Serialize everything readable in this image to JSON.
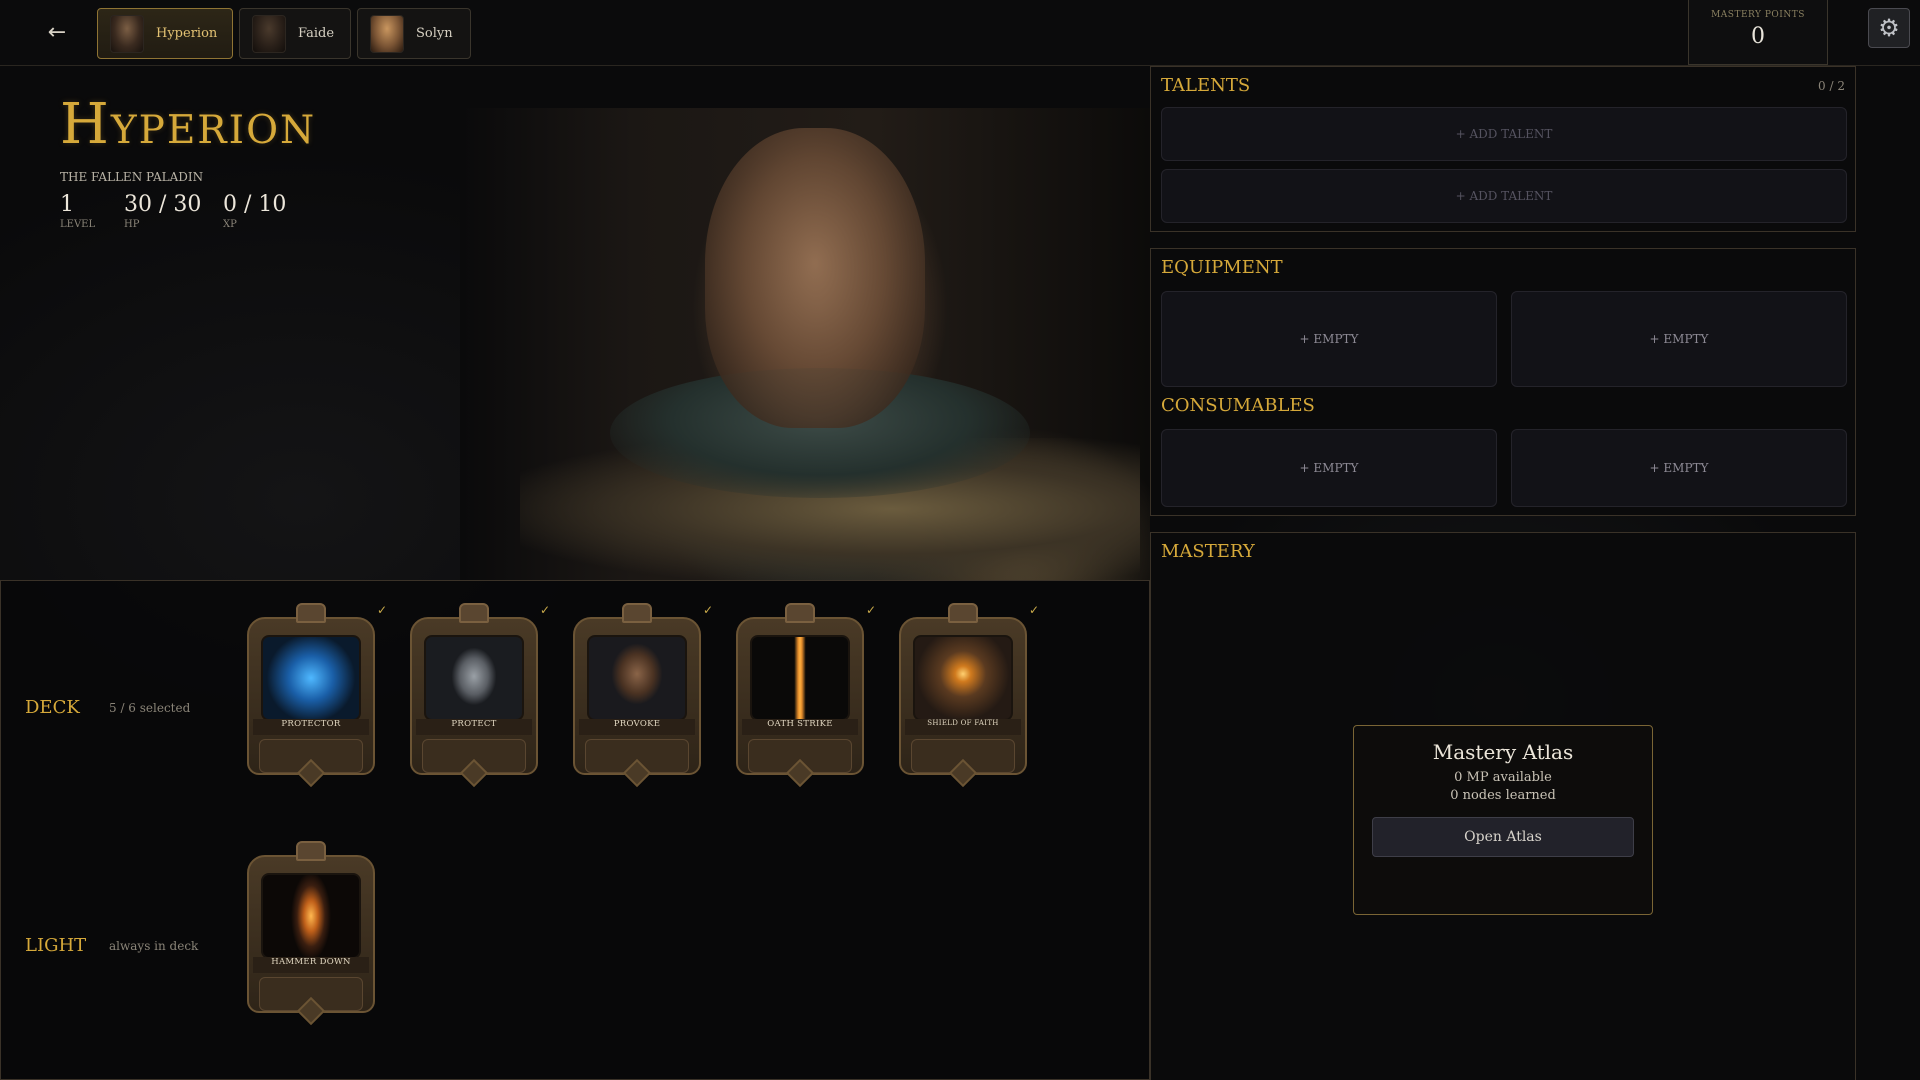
{
  "topbar": {
    "back_icon": "arrow-left",
    "tabs": [
      {
        "label": "Hyperion",
        "active": true
      },
      {
        "label": "Faide",
        "active": false
      },
      {
        "label": "Solyn",
        "active": false
      }
    ],
    "mastery_points": {
      "label": "MASTERY POINTS",
      "value": "0"
    },
    "settings_icon": "gear"
  },
  "hero": {
    "name": "Hyperion",
    "subtitle": "THE FALLEN PALADIN",
    "stats": [
      {
        "value": "1",
        "label": "LEVEL"
      },
      {
        "value": "30 / 30",
        "label": "HP"
      },
      {
        "value": "0 / 10",
        "label": "XP"
      }
    ]
  },
  "deck": {
    "title": "DECK",
    "subtitle": "5 / 6 selected",
    "cards": [
      {
        "name": "PROTECTOR",
        "selected": true
      },
      {
        "name": "PROTECT",
        "selected": true
      },
      {
        "name": "PROVOKE",
        "selected": true
      },
      {
        "name": "OATH STRIKE",
        "selected": true
      },
      {
        "name": "SHIELD OF FAITH",
        "selected": true
      }
    ],
    "check_mark": "✓"
  },
  "light": {
    "title": "LIGHT",
    "subtitle": "always in deck",
    "cards": [
      {
        "name": "HAMMER DOWN"
      }
    ]
  },
  "talents": {
    "title": "TALENTS",
    "count": "0 / 2",
    "slots": [
      "+ ADD TALENT",
      "+ ADD TALENT"
    ]
  },
  "equipment": {
    "title": "EQUIPMENT",
    "slots": [
      "+ EMPTY",
      "+ EMPTY"
    ]
  },
  "consumables": {
    "title": "CONSUMABLES",
    "slots": [
      "+ EMPTY",
      "+ EMPTY"
    ]
  },
  "mastery": {
    "title": "MASTERY",
    "atlas": {
      "title": "Mastery Atlas",
      "mp": "0 MP available",
      "nodes": "0 nodes learned",
      "button": "Open Atlas"
    }
  },
  "colors": {
    "gold": "#d6a93a",
    "background": "#0a0a0b"
  }
}
